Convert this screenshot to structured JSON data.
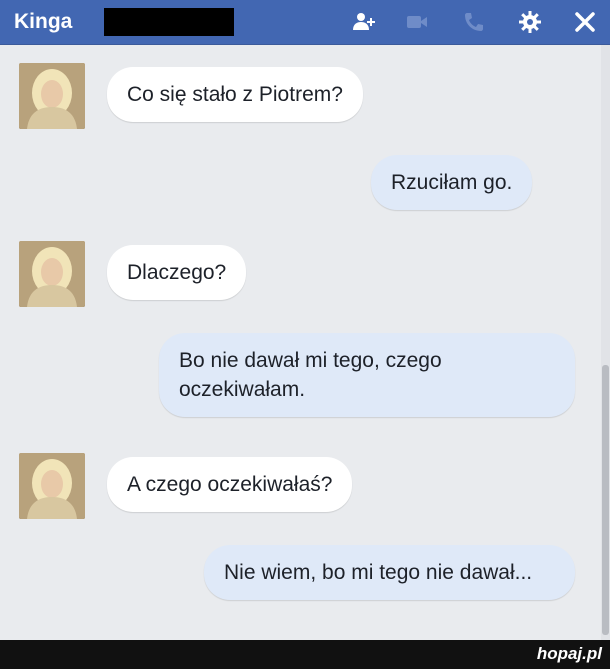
{
  "header": {
    "title": "Kinga",
    "icons": [
      "add-people-icon",
      "video-call-icon",
      "phone-icon",
      "gear-icon",
      "close-icon"
    ],
    "background_color": "#4267b2"
  },
  "messages": [
    {
      "direction": "incoming",
      "text": "Co się stało z Piotrem?"
    },
    {
      "direction": "outgoing",
      "text": "Rzuciłam go."
    },
    {
      "direction": "incoming",
      "text": "Dlaczego?"
    },
    {
      "direction": "outgoing",
      "text": "Bo nie dawał mi tego, czego oczekiwałam."
    },
    {
      "direction": "incoming",
      "text": "A czego oczekiwałaś?"
    },
    {
      "direction": "outgoing",
      "text": "Nie wiem, bo mi tego nie dawał..."
    }
  ],
  "footer": {
    "watermark": "hopaj.pl"
  }
}
